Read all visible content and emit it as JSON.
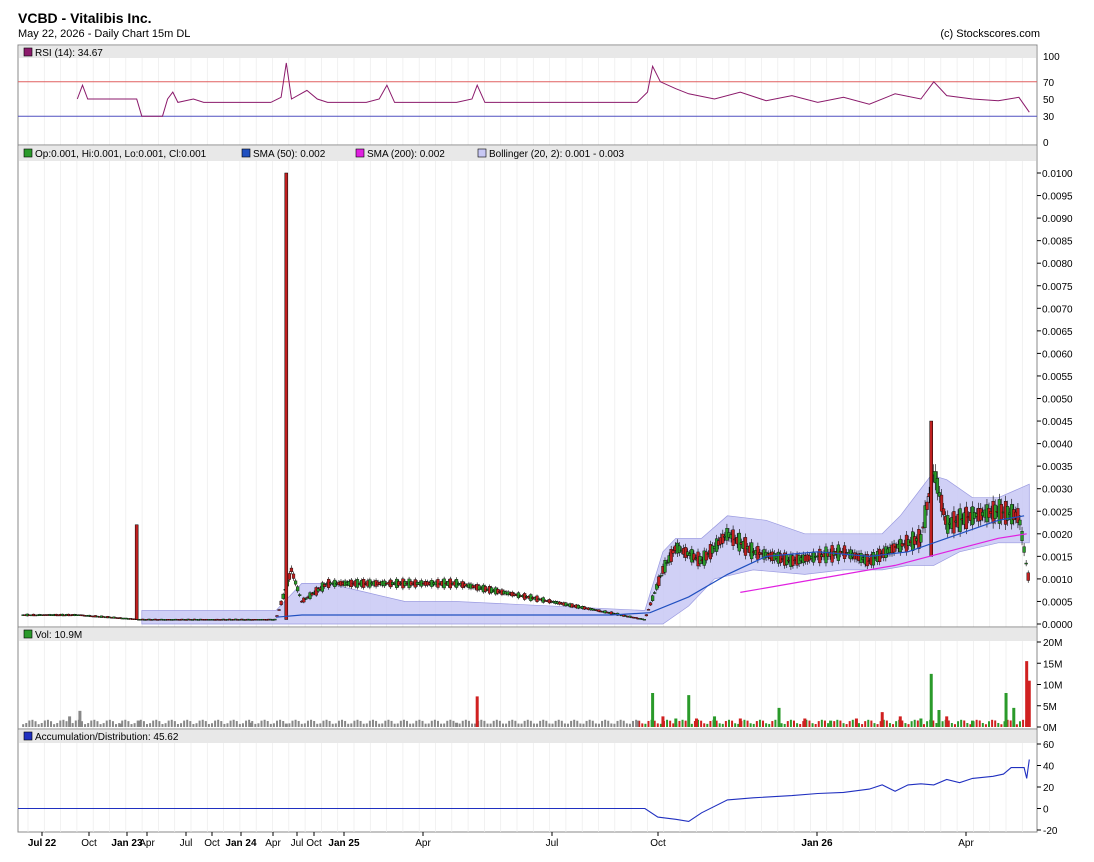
{
  "header": {
    "title": "VCBD - Vitalibis Inc.",
    "subtitle": "May 22, 2026 - Daily Chart 15m DL",
    "copyright": "(c) Stockscores.com"
  },
  "colors": {
    "rsi_line": "#8b1a6b",
    "upper_band_line": "#e06060",
    "lower_band_line": "#5050c0",
    "up_candle": "#2a9a2a",
    "down_candle": "#c02020",
    "sma50": "#2050c0",
    "sma200": "#e020e0",
    "bollinger_fill": "#c8c8f4",
    "accdist": "#2030c0",
    "volume_up": "#2a9a2a",
    "volume_down": "#d02020",
    "volume_flat": "#888888"
  },
  "chart_data": [
    {
      "type": "line",
      "panel": "RSI",
      "legend": "RSI (14): 34.67",
      "ylim": [
        0,
        100
      ],
      "yticks": [
        {
          "v": 100,
          "label": "100"
        },
        {
          "v": 70,
          "label": "70"
        },
        {
          "v": 50,
          "label": "50"
        },
        {
          "v": 30,
          "label": "30"
        },
        {
          "v": 0,
          "label": "0"
        }
      ],
      "levels": [
        70,
        30
      ],
      "series": [
        {
          "values": [
            [
              2022.73,
              50
            ],
            [
              2022.75,
              66
            ],
            [
              2022.77,
              50
            ],
            [
              2022.96,
              50
            ],
            [
              2022.98,
              30
            ],
            [
              2023.06,
              30
            ],
            [
              2023.08,
              50
            ],
            [
              2023.1,
              58
            ],
            [
              2023.12,
              46
            ],
            [
              2023.18,
              50
            ],
            [
              2023.22,
              46
            ],
            [
              2023.3,
              46
            ],
            [
              2023.48,
              46
            ],
            [
              2023.52,
              52
            ],
            [
              2023.54,
              92
            ],
            [
              2023.56,
              50
            ],
            [
              2023.62,
              60
            ],
            [
              2023.66,
              50
            ],
            [
              2023.7,
              46
            ],
            [
              2023.85,
              46
            ],
            [
              2023.9,
              50
            ],
            [
              2023.93,
              66
            ],
            [
              2023.96,
              46
            ],
            [
              2024.2,
              46
            ],
            [
              2024.26,
              50
            ],
            [
              2024.28,
              66
            ],
            [
              2024.31,
              46
            ],
            [
              2024.9,
              46
            ],
            [
              2024.94,
              58
            ],
            [
              2024.96,
              88
            ],
            [
              2024.99,
              70
            ],
            [
              2025.05,
              62
            ],
            [
              2025.1,
              56
            ],
            [
              2025.2,
              50
            ],
            [
              2025.3,
              58
            ],
            [
              2025.4,
              48
            ],
            [
              2025.5,
              54
            ],
            [
              2025.6,
              46
            ],
            [
              2025.7,
              52
            ],
            [
              2025.8,
              44
            ],
            [
              2025.9,
              56
            ],
            [
              2026.0,
              50
            ],
            [
              2026.05,
              70
            ],
            [
              2026.1,
              54
            ],
            [
              2026.2,
              50
            ],
            [
              2026.3,
              48
            ],
            [
              2026.38,
              52
            ],
            [
              2026.42,
              34.67
            ]
          ]
        }
      ]
    },
    {
      "type": "candlestick",
      "panel": "Price",
      "legend": [
        "Op:0.001, Hi:0.001, Lo:0.001, Cl:0.001",
        "SMA (50): 0.002",
        "SMA (200): 0.002",
        "Bollinger (20, 2): 0.001 - 0.003"
      ],
      "ylim": [
        0,
        0.01
      ],
      "yticks": [
        "0.0000",
        "0.0005",
        "0.0010",
        "0.0015",
        "0.0020",
        "0.0025",
        "0.0030",
        "0.0035",
        "0.0040",
        "0.0045",
        "0.0050",
        "0.0055",
        "0.0060",
        "0.0065",
        "0.0070",
        "0.0075",
        "0.0080",
        "0.0085",
        "0.0090",
        "0.0095",
        "0.0100"
      ],
      "spikes": [
        {
          "x": 2022.96,
          "high": 0.0022,
          "low": 0.0001
        },
        {
          "x": 2023.54,
          "high": 0.01,
          "low": 0.0001
        },
        {
          "x": 2026.04,
          "high": 0.0045,
          "low": 0.0015
        }
      ],
      "sma50": [
        [
          2023.5,
          0.00015
        ],
        [
          2023.6,
          0.0002
        ],
        [
          2024.8,
          0.0002
        ],
        [
          2024.95,
          0.00025
        ],
        [
          2025.1,
          0.0006
        ],
        [
          2025.25,
          0.0011
        ],
        [
          2025.4,
          0.0015
        ],
        [
          2025.6,
          0.0016
        ],
        [
          2025.8,
          0.0015
        ],
        [
          2025.95,
          0.0016
        ],
        [
          2026.1,
          0.0019
        ],
        [
          2026.2,
          0.0021
        ],
        [
          2026.3,
          0.0023
        ],
        [
          2026.4,
          0.0024
        ]
      ],
      "sma200": [
        [
          2025.3,
          0.0007
        ],
        [
          2025.6,
          0.001
        ],
        [
          2025.9,
          0.0013
        ],
        [
          2026.1,
          0.0016
        ],
        [
          2026.3,
          0.0019
        ],
        [
          2026.41,
          0.002
        ]
      ],
      "bollinger_upper": [
        [
          2022.98,
          0.0003
        ],
        [
          2023.5,
          0.0003
        ],
        [
          2023.6,
          0.0009
        ],
        [
          2023.7,
          0.0009
        ],
        [
          2023.85,
          0.0007
        ],
        [
          2024.0,
          0.0005
        ],
        [
          2024.2,
          0.0005
        ],
        [
          2024.93,
          0.0003
        ],
        [
          2025.0,
          0.0016
        ],
        [
          2025.05,
          0.0019
        ],
        [
          2025.15,
          0.0019
        ],
        [
          2025.25,
          0.0024
        ],
        [
          2025.4,
          0.0023
        ],
        [
          2025.55,
          0.002
        ],
        [
          2025.7,
          0.002
        ],
        [
          2025.85,
          0.002
        ],
        [
          2025.92,
          0.0024
        ],
        [
          2026.04,
          0.0033
        ],
        [
          2026.1,
          0.0032
        ],
        [
          2026.2,
          0.0028
        ],
        [
          2026.3,
          0.0028
        ],
        [
          2026.42,
          0.0031
        ]
      ],
      "bollinger_lower": [
        [
          2022.98,
          0.0
        ],
        [
          2023.5,
          0.0
        ],
        [
          2023.6,
          0.0
        ],
        [
          2024.93,
          0.0
        ],
        [
          2025.0,
          0.0
        ],
        [
          2025.1,
          0.0004
        ],
        [
          2025.2,
          0.001
        ],
        [
          2025.35,
          0.0012
        ],
        [
          2025.55,
          0.0011
        ],
        [
          2025.7,
          0.0012
        ],
        [
          2025.85,
          0.0012
        ],
        [
          2025.95,
          0.0013
        ],
        [
          2026.05,
          0.0013
        ],
        [
          2026.15,
          0.0016
        ],
        [
          2026.3,
          0.0018
        ],
        [
          2026.42,
          0.0018
        ]
      ],
      "closes": [
        [
          2022.73,
          0.0002
        ],
        [
          2022.98,
          0.0001
        ],
        [
          2023.5,
          0.0001
        ],
        [
          2023.56,
          0.0012
        ],
        [
          2023.6,
          0.0005
        ],
        [
          2023.7,
          0.0009
        ],
        [
          2024.2,
          0.0009
        ],
        [
          2024.93,
          0.0001
        ],
        [
          2025.0,
          0.0012
        ],
        [
          2025.05,
          0.0017
        ],
        [
          2025.15,
          0.0014
        ],
        [
          2025.25,
          0.002
        ],
        [
          2025.35,
          0.0016
        ],
        [
          2025.5,
          0.0014
        ],
        [
          2025.6,
          0.0015
        ],
        [
          2025.7,
          0.0016
        ],
        [
          2025.8,
          0.0014
        ],
        [
          2025.9,
          0.0017
        ],
        [
          2026.0,
          0.0019
        ],
        [
          2026.05,
          0.0034
        ],
        [
          2026.1,
          0.0022
        ],
        [
          2026.2,
          0.0024
        ],
        [
          2026.3,
          0.0025
        ],
        [
          2026.38,
          0.0024
        ],
        [
          2026.42,
          0.0009
        ]
      ]
    },
    {
      "type": "bar",
      "panel": "Volume",
      "legend": "Vol: 10.9M",
      "ylim": [
        0,
        20
      ],
      "yticks": [
        {
          "v": 20,
          "label": "20M"
        },
        {
          "v": 15,
          "label": "15M"
        },
        {
          "v": 10,
          "label": "10M"
        },
        {
          "v": 5,
          "label": "5M"
        },
        {
          "v": 0,
          "label": "0M"
        }
      ],
      "bars": [
        [
          2022.7,
          2.5,
          "flat"
        ],
        [
          2022.74,
          3.8,
          "flat"
        ],
        [
          2022.9,
          0.8,
          "flat"
        ],
        [
          2022.97,
          1.5,
          "flat"
        ],
        [
          2023.4,
          1.0,
          "flat"
        ],
        [
          2023.54,
          0.8,
          "flat"
        ],
        [
          2024.2,
          1.0,
          "flat"
        ],
        [
          2024.28,
          7.2,
          "down"
        ],
        [
          2024.9,
          1.5,
          "flat"
        ],
        [
          2024.96,
          8.0,
          "up"
        ],
        [
          2025.0,
          2.5,
          "down"
        ],
        [
          2025.05,
          2.0,
          "up"
        ],
        [
          2025.1,
          7.5,
          "up"
        ],
        [
          2025.13,
          2.0,
          "down"
        ],
        [
          2025.2,
          2.5,
          "up"
        ],
        [
          2025.3,
          2.0,
          "down"
        ],
        [
          2025.45,
          4.5,
          "up"
        ],
        [
          2025.55,
          2.0,
          "down"
        ],
        [
          2025.65,
          1.5,
          "up"
        ],
        [
          2025.75,
          2.0,
          "down"
        ],
        [
          2025.85,
          3.5,
          "down"
        ],
        [
          2025.92,
          2.5,
          "down"
        ],
        [
          2026.0,
          2.0,
          "up"
        ],
        [
          2026.04,
          12.5,
          "up"
        ],
        [
          2026.07,
          4.0,
          "up"
        ],
        [
          2026.1,
          2.5,
          "down"
        ],
        [
          2026.2,
          1.5,
          "up"
        ],
        [
          2026.33,
          8.0,
          "up"
        ],
        [
          2026.36,
          4.5,
          "up"
        ],
        [
          2026.41,
          15.5,
          "down"
        ],
        [
          2026.42,
          10.9,
          "down"
        ]
      ]
    },
    {
      "type": "line",
      "panel": "Accumulation/Distribution",
      "legend": "Accumulation/Distribution: 45.62",
      "ylim": [
        -20,
        60
      ],
      "yticks": [
        {
          "v": 60,
          "label": "60"
        },
        {
          "v": 40,
          "label": "40"
        },
        {
          "v": 20,
          "label": "20"
        },
        {
          "v": 0,
          "label": "0"
        },
        {
          "v": -20,
          "label": "-20"
        }
      ],
      "series": [
        {
          "values": [
            [
              2022.5,
              0
            ],
            [
              2024.93,
              0
            ],
            [
              2024.98,
              -8
            ],
            [
              2025.05,
              -10
            ],
            [
              2025.1,
              -12
            ],
            [
              2025.15,
              -4
            ],
            [
              2025.25,
              8
            ],
            [
              2025.35,
              10
            ],
            [
              2025.5,
              12
            ],
            [
              2025.6,
              14
            ],
            [
              2025.7,
              15
            ],
            [
              2025.8,
              18
            ],
            [
              2025.85,
              22
            ],
            [
              2025.9,
              16
            ],
            [
              2025.95,
              22
            ],
            [
              2026.0,
              23
            ],
            [
              2026.05,
              22
            ],
            [
              2026.1,
              27
            ],
            [
              2026.15,
              24
            ],
            [
              2026.2,
              28
            ],
            [
              2026.28,
              30
            ],
            [
              2026.32,
              32
            ],
            [
              2026.35,
              38
            ],
            [
              2026.4,
              38
            ],
            [
              2026.41,
              28
            ],
            [
              2026.42,
              45.62
            ]
          ]
        }
      ]
    }
  ],
  "xaxis": {
    "ticks": [
      "Jul 22",
      "Oct",
      "Jan 23",
      "Apr",
      "Jul",
      "Oct",
      "Jan 24",
      "Apr",
      "Jul",
      "Oct",
      "Jan 25",
      "Apr",
      "Jul",
      "Oct",
      "Jan 26",
      "Apr"
    ],
    "bold": [
      "Jul 22",
      "Jan 23",
      "Jan 24",
      "Jan 25",
      "Jan 26"
    ]
  }
}
